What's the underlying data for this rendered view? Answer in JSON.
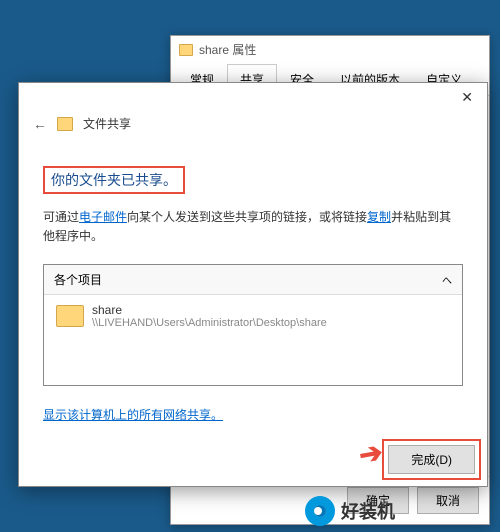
{
  "props_dialog": {
    "title": "share 属性",
    "tabs": [
      "常规",
      "共享",
      "安全",
      "以前的版本",
      "自定义"
    ],
    "active_tab_index": 1,
    "buttons": {
      "ok": "确定",
      "cancel": "取消"
    }
  },
  "share_dialog": {
    "header": "文件共享",
    "heading": "你的文件夹已共享。",
    "instruction_prefix": "可通过",
    "instruction_link_email": "电子邮件",
    "instruction_mid": "向某个人发送到这些共享项的链接，或将链接",
    "instruction_link_copy": "复制",
    "instruction_suffix": "并粘贴到其他程序中。",
    "items_header": "各个项目",
    "item": {
      "name": "share",
      "path": "\\\\LIVEHAND\\Users\\Administrator\\Desktop\\share"
    },
    "show_all_link": "显示该计算机上的所有网络共享。",
    "done_button": "完成(D)"
  },
  "watermark": "好装机"
}
